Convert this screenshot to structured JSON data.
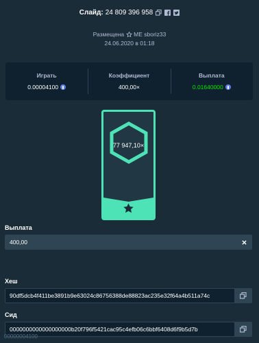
{
  "header": {
    "slide_label": "Слайд:",
    "slide_number": "24 809 396 958",
    "placed_prefix": "Размещена",
    "username": "ME sboriz33",
    "date": "24.06.2020 в 01:18"
  },
  "stats": {
    "bet_label": "Играть",
    "bet_value": "0.00004100",
    "multiplier_label": "Коэффициент",
    "multiplier_value": "400,00×",
    "payout_label": "Выплата",
    "payout_value": "0.01640000"
  },
  "card": {
    "value": "77 947,10×"
  },
  "payout_field": {
    "label": "Выплата",
    "value": "400,00"
  },
  "hash_field": {
    "label": "Хеш",
    "value": "90df5dcb4f411be3891b9e63024c86756388de88823ac235e32f64a4b511a74c"
  },
  "seed_field": {
    "label": "Сид",
    "value": "0000000000000000000b20f796f5421cac95c4efb06c6bbf6408d6f9b5d7b"
  },
  "bottom_ghost": "00000004100",
  "colors": {
    "background": "#1a2c38",
    "panel": "#0f212e",
    "accent": "#4ee3b7",
    "win_green": "#00e701",
    "coin": "#627eea"
  },
  "icons": {
    "copy": "copy-icon",
    "facebook": "facebook-icon",
    "twitter": "twitter-icon",
    "star_outline": "star-outline-icon",
    "coin": "ethereum-coin-icon",
    "hexagon": "hexagon-icon",
    "star_filled": "star-icon",
    "clear": "close-icon"
  }
}
